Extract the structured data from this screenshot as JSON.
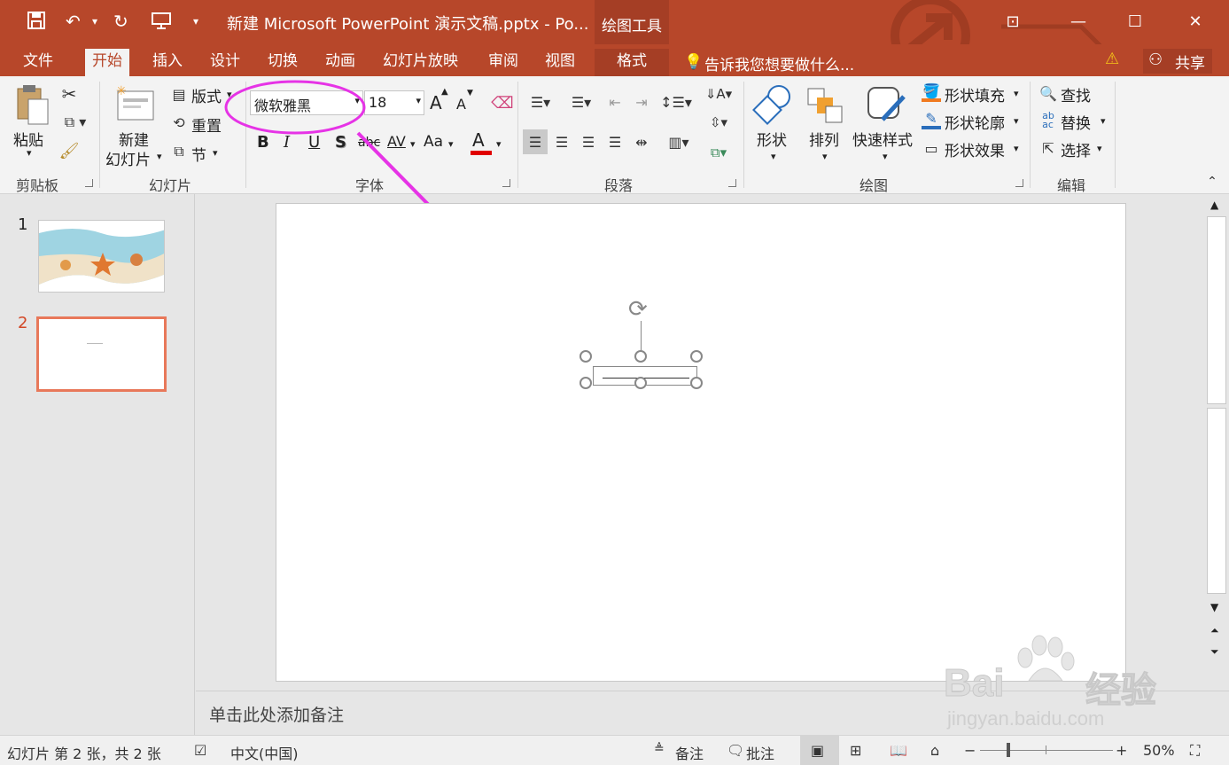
{
  "window": {
    "title": "新建 Microsoft PowerPoint 演示文稿.pptx - Po...",
    "context_tools": "绘图工具",
    "share_label": "共享"
  },
  "tabs": [
    "文件",
    "开始",
    "插入",
    "设计",
    "切换",
    "动画",
    "幻灯片放映",
    "审阅",
    "视图",
    "格式"
  ],
  "tell_me": "告诉我您想要做什么...",
  "ribbon": {
    "clipboard": {
      "paste": "粘贴",
      "group": "剪贴板"
    },
    "slides": {
      "new_slide_1": "新建",
      "new_slide_2": "幻灯片",
      "layout": "版式",
      "reset": "重置",
      "section": "节",
      "group": "幻灯片"
    },
    "font": {
      "name": "微软雅黑",
      "size": "18",
      "bold": "B",
      "italic": "I",
      "underline": "U",
      "shadow": "S",
      "strike": "abc",
      "spacing": "AV",
      "case": "Aa",
      "color_a": "A",
      "grow": "A",
      "shrink": "A",
      "group": "字体"
    },
    "paragraph": {
      "group": "段落"
    },
    "drawing": {
      "shapes": "形状",
      "arrange": "排列",
      "quick_styles": "快速样式",
      "fill": "形状填充",
      "outline": "形状轮廓",
      "effects": "形状效果",
      "group": "绘图"
    },
    "editing": {
      "find": "查找",
      "replace": "替换",
      "select": "选择",
      "group": "编辑"
    }
  },
  "slides": [
    {
      "number": "1"
    },
    {
      "number": "2"
    }
  ],
  "notes_placeholder": "单击此处添加备注",
  "status": {
    "slide_info": "幻灯片 第 2 张，共 2 张",
    "language": "中文(中国)",
    "notes": "备注",
    "comments": "批注",
    "zoom": "50%"
  },
  "watermark": {
    "brand": "Bai",
    "brand_cn": "经验",
    "url": "jingyan.baidu.com"
  },
  "colors": {
    "accent": "#b7472a",
    "annotation": "#e633e6",
    "font_color_bar": "#e00000"
  }
}
